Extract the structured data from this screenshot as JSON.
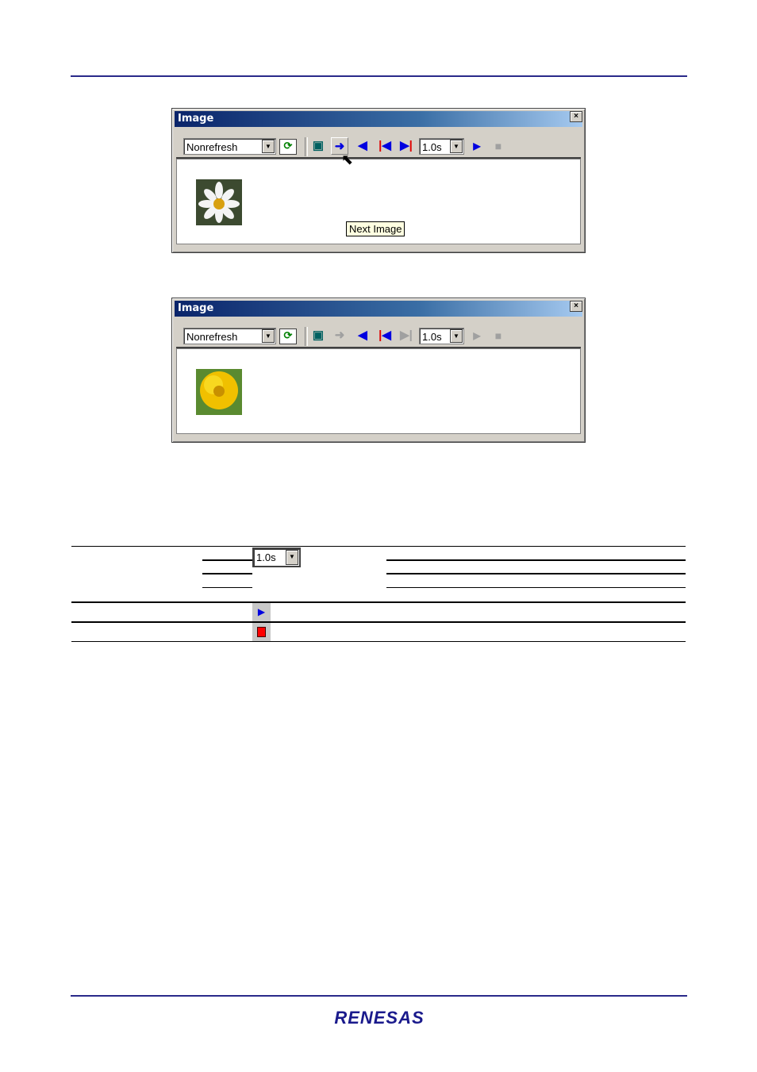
{
  "windows": [
    {
      "title": "Image",
      "mode": "Nonrefresh",
      "interval": "1.0s",
      "tooltip": "Next Image",
      "thumbnail": "daisy",
      "next_enabled": true,
      "last_enabled": true,
      "play_enabled": true
    },
    {
      "title": "Image",
      "mode": "Nonrefresh",
      "interval": "1.0s",
      "thumbnail": "yellow-flower",
      "next_enabled": false,
      "last_enabled": false,
      "play_enabled": false
    }
  ],
  "table": {
    "interval": "1.0s",
    "icons": [
      "play-icon",
      "stop-icon"
    ]
  },
  "footer": {
    "logo": "RENESAS"
  },
  "colors": {
    "rule": "#2a2a8a",
    "accent_blue": "#0000e0",
    "accent_red": "#e00000"
  }
}
